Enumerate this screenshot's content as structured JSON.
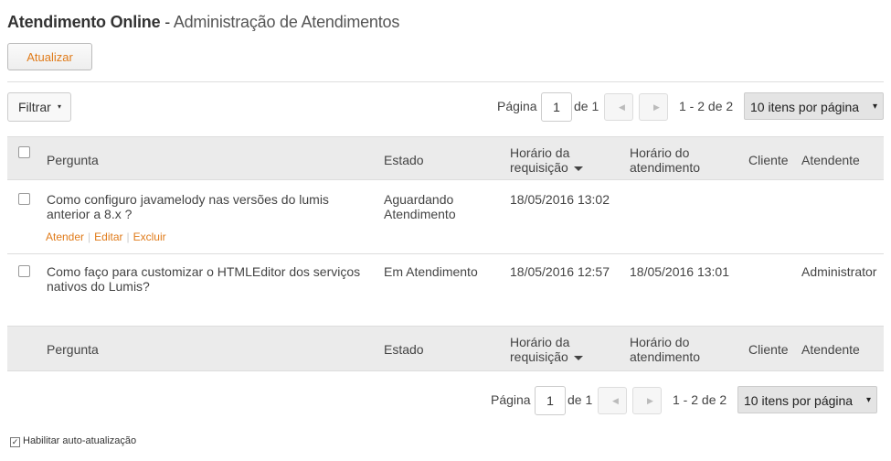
{
  "header": {
    "app_title": "Atendimento Online",
    "separator": " - ",
    "page_title": "Administração de Atendimentos"
  },
  "toolbar": {
    "refresh_label": "Atualizar"
  },
  "filter": {
    "label": "Filtrar",
    "caret_icon": "▾"
  },
  "pagination": {
    "page_label": "Página",
    "current_page": "1",
    "of_label": "de 1",
    "range_label": "1 - 2 de 2",
    "per_page": "10 itens por página",
    "prev_icon": "◀",
    "next_icon": "▶",
    "dropdown_icon": "▾"
  },
  "table": {
    "columns": {
      "question": "Pergunta",
      "state": "Estado",
      "request_time_line1": "Horário da",
      "request_time_line2": "requisição",
      "service_time_line1": "Horário do",
      "service_time_line2": "atendimento",
      "client": "Cliente",
      "attendant": "Atendente"
    },
    "rows": [
      {
        "question": "Como configuro javamelody nas versões do lumis anterior a 8.x ?",
        "state": "Aguardando Atendimento",
        "request_time": "18/05/2016 13:02",
        "service_time": "",
        "client": "",
        "attendant": "",
        "actions": {
          "attend": "Atender",
          "edit": "Editar",
          "delete": "Excluir"
        }
      },
      {
        "question": "Como faço para customizar o HTMLEditor dos serviços nativos do Lumis?",
        "state": "Em Atendimento",
        "request_time": "18/05/2016 12:57",
        "service_time": "18/05/2016 13:01",
        "client": "",
        "attendant": "Administrator"
      }
    ]
  },
  "auto_update": {
    "label": "Habilitar auto-atualização",
    "checked": true,
    "check_icon": "✓"
  },
  "colors": {
    "accent": "#e07b1a",
    "header_bg": "#ebebeb"
  }
}
